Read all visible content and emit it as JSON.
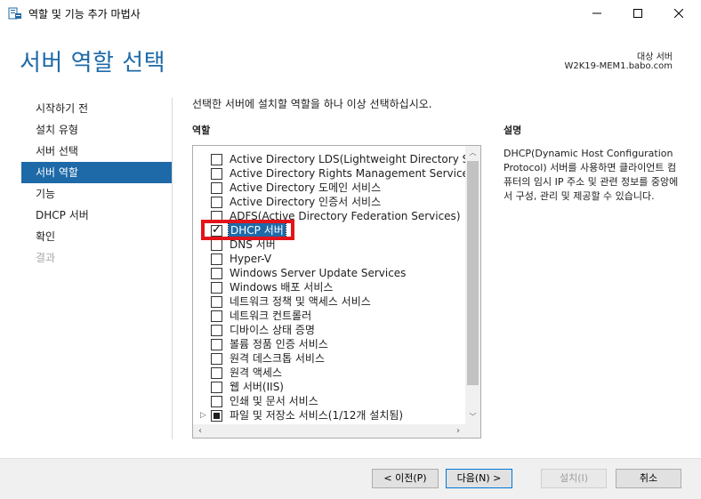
{
  "window": {
    "title": "역할 및 기능 추가 마법사",
    "minimize_icon": "minimize-icon",
    "maximize_icon": "maximize-icon",
    "close_icon": "close-icon"
  },
  "header": {
    "title": "서버 역할 선택",
    "target_label": "대상 서버",
    "target_server": "W2K19-MEM1.babo.com"
  },
  "nav": {
    "items": [
      {
        "label": "시작하기 전",
        "state": "normal"
      },
      {
        "label": "설치 유형",
        "state": "normal"
      },
      {
        "label": "서버 선택",
        "state": "normal"
      },
      {
        "label": "서버 역할",
        "state": "active"
      },
      {
        "label": "기능",
        "state": "normal"
      },
      {
        "label": "DHCP 서버",
        "state": "normal"
      },
      {
        "label": "확인",
        "state": "normal"
      },
      {
        "label": "결과",
        "state": "disabled"
      }
    ]
  },
  "main": {
    "instruction": "선택한 서버에 설치할 역할을 하나 이상 선택하십시오.",
    "roles_heading": "역할",
    "description_heading": "설명",
    "description": "DHCP(Dynamic Host Configuration Protocol) 서버를 사용하면 클라이언트 컴퓨터의 임시 IP 주소 및 관련 정보를 중앙에서 구성, 관리 및 제공할 수 있습니다.",
    "roles": [
      {
        "label": "Active Directory LDS(Lightweight Directory Services)",
        "checked": false
      },
      {
        "label": "Active Directory Rights Management Services",
        "checked": false
      },
      {
        "label": "Active Directory 도메인 서비스",
        "checked": false
      },
      {
        "label": "Active Directory 인증서 서비스",
        "checked": false
      },
      {
        "label": "ADFS(Active Directory Federation Services)",
        "checked": false
      },
      {
        "label": "DHCP 서버",
        "checked": true,
        "selected": true
      },
      {
        "label": "DNS 서버",
        "checked": false
      },
      {
        "label": "Hyper-V",
        "checked": false
      },
      {
        "label": "Windows Server Update Services",
        "checked": false
      },
      {
        "label": "Windows 배포 서비스",
        "checked": false
      },
      {
        "label": "네트워크 정책 및 액세스 서비스",
        "checked": false
      },
      {
        "label": "네트워크 컨트롤러",
        "checked": false
      },
      {
        "label": "디바이스 상태 증명",
        "checked": false
      },
      {
        "label": "볼륨 정품 인증 서비스",
        "checked": false
      },
      {
        "label": "원격 데스크톱 서비스",
        "checked": false
      },
      {
        "label": "원격 액세스",
        "checked": false
      },
      {
        "label": "웹 서버(IIS)",
        "checked": false
      },
      {
        "label": "인쇄 및 문서 서비스",
        "checked": false
      },
      {
        "label": "파일 및 저장소 서비스(1/12개 설치됨)",
        "checked": "partial",
        "expandable": true
      }
    ]
  },
  "footer": {
    "prev_label": "< 이전(P)",
    "next_label": "다음(N) >",
    "install_label": "설치(I)",
    "cancel_label": "취소"
  },
  "colors": {
    "accent": "#1e6aa8",
    "highlight": "#e3141b"
  }
}
